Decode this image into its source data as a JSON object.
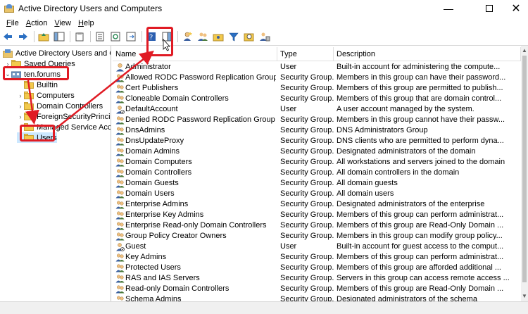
{
  "window": {
    "title": "Active Directory Users and Computers",
    "minimize_glyph": "—",
    "close_glyph": "✕"
  },
  "menu": [
    {
      "label": "File",
      "accel": "F",
      "rest": "ile"
    },
    {
      "label": "Action",
      "accel": "A",
      "rest": "ction"
    },
    {
      "label": "View",
      "accel": "V",
      "rest": "iew"
    },
    {
      "label": "Help",
      "accel": "H",
      "rest": "elp"
    }
  ],
  "tree": {
    "root": "Active Directory Users and Com",
    "saved_queries": "Saved Queries",
    "domain": "ten.forums",
    "children": [
      "Builtin",
      "Computers",
      "Domain Controllers",
      "ForeignSecurityPrincipals",
      "Managed Service Accour",
      "Users"
    ]
  },
  "columns": {
    "name": "Name",
    "type": "Type",
    "description": "Description"
  },
  "rows": [
    {
      "name": "Administrator",
      "type": "User",
      "desc": "Built-in account for administering the compute...",
      "icon": "user"
    },
    {
      "name": "Allowed RODC Password Replication Group",
      "type": "Security Group...",
      "desc": "Members in this group can have their password...",
      "icon": "group"
    },
    {
      "name": "Cert Publishers",
      "type": "Security Group...",
      "desc": "Members of this group are permitted to publish...",
      "icon": "group"
    },
    {
      "name": "Cloneable Domain Controllers",
      "type": "Security Group...",
      "desc": "Members of this group that are domain control...",
      "icon": "group"
    },
    {
      "name": "DefaultAccount",
      "type": "User",
      "desc": "A user account managed by the system.",
      "icon": "user-disabled"
    },
    {
      "name": "Denied RODC Password Replication Group",
      "type": "Security Group...",
      "desc": "Members in this group cannot have their passw...",
      "icon": "group"
    },
    {
      "name": "DnsAdmins",
      "type": "Security Group...",
      "desc": "DNS Administrators Group",
      "icon": "group"
    },
    {
      "name": "DnsUpdateProxy",
      "type": "Security Group...",
      "desc": "DNS clients who are permitted to perform dyna...",
      "icon": "group"
    },
    {
      "name": "Domain Admins",
      "type": "Security Group...",
      "desc": "Designated administrators of the domain",
      "icon": "group"
    },
    {
      "name": "Domain Computers",
      "type": "Security Group...",
      "desc": "All workstations and servers joined to the domain",
      "icon": "group"
    },
    {
      "name": "Domain Controllers",
      "type": "Security Group...",
      "desc": "All domain controllers in the domain",
      "icon": "group"
    },
    {
      "name": "Domain Guests",
      "type": "Security Group...",
      "desc": "All domain guests",
      "icon": "group"
    },
    {
      "name": "Domain Users",
      "type": "Security Group...",
      "desc": "All domain users",
      "icon": "group"
    },
    {
      "name": "Enterprise Admins",
      "type": "Security Group...",
      "desc": "Designated administrators of the enterprise",
      "icon": "group"
    },
    {
      "name": "Enterprise Key Admins",
      "type": "Security Group...",
      "desc": "Members of this group can perform administrat...",
      "icon": "group"
    },
    {
      "name": "Enterprise Read-only Domain Controllers",
      "type": "Security Group...",
      "desc": "Members of this group are Read-Only Domain ...",
      "icon": "group"
    },
    {
      "name": "Group Policy Creator Owners",
      "type": "Security Group...",
      "desc": "Members in this group can modify group policy...",
      "icon": "group"
    },
    {
      "name": "Guest",
      "type": "User",
      "desc": "Built-in account for guest access to the comput...",
      "icon": "user-disabled"
    },
    {
      "name": "Key Admins",
      "type": "Security Group...",
      "desc": "Members of this group can perform administrat...",
      "icon": "group"
    },
    {
      "name": "Protected Users",
      "type": "Security Group...",
      "desc": "Members of this group are afforded additional ...",
      "icon": "group"
    },
    {
      "name": "RAS and IAS Servers",
      "type": "Security Group...",
      "desc": "Servers in this group can access remote access ...",
      "icon": "group"
    },
    {
      "name": "Read-only Domain Controllers",
      "type": "Security Group...",
      "desc": "Members of this group are Read-Only Domain ...",
      "icon": "group"
    },
    {
      "name": "Schema Admins",
      "type": "Security Group...",
      "desc": "Designated administrators of the schema",
      "icon": "group"
    }
  ],
  "colors": {
    "highlight": "#e01b24",
    "user_head": "#f0c080",
    "user_body": "#3a5fa0",
    "group_body": "#4a7a3a"
  }
}
